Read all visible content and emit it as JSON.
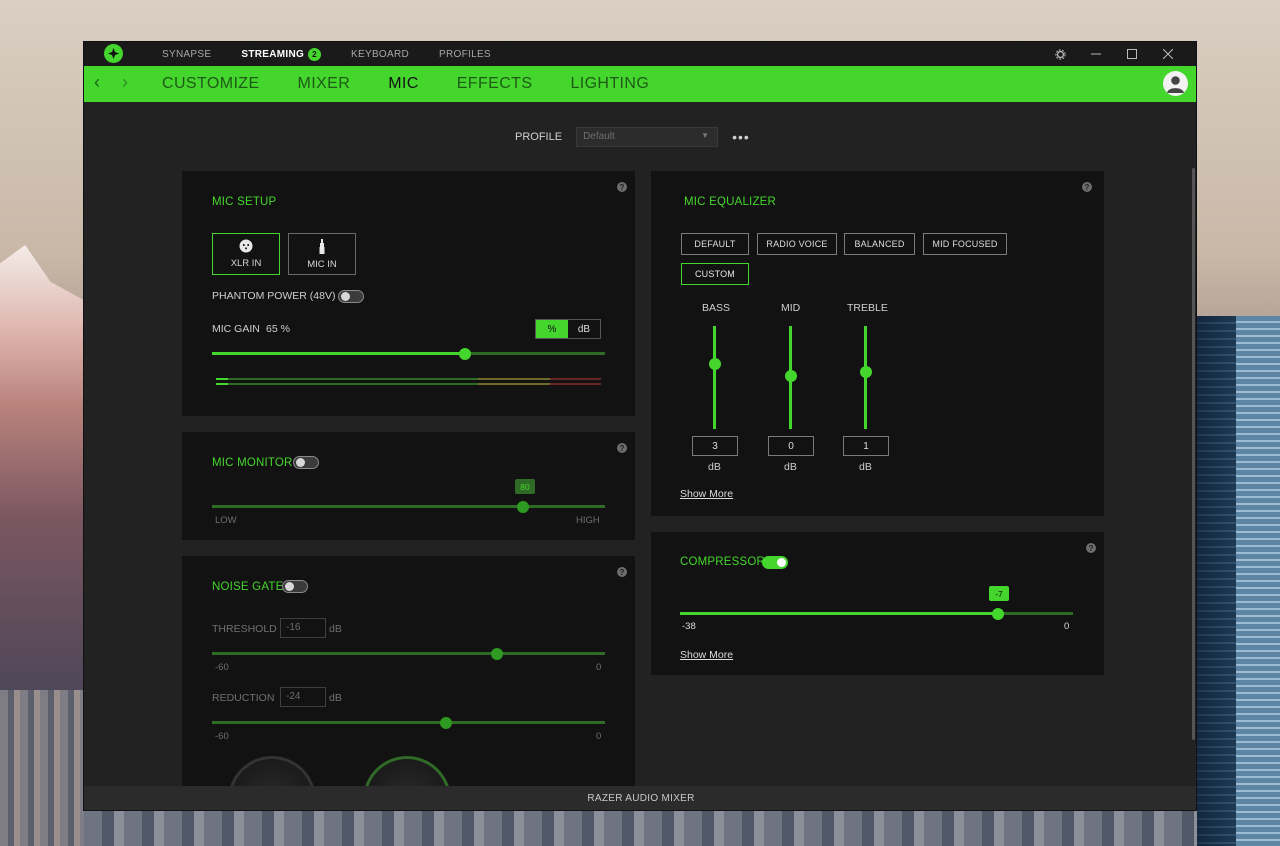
{
  "titlebar": {
    "tabs": [
      {
        "label": "SYNAPSE"
      },
      {
        "label": "STREAMING",
        "badge": "2"
      },
      {
        "label": "KEYBOARD"
      },
      {
        "label": "PROFILES"
      }
    ],
    "settings_icon": "gear-icon",
    "minimize_icon": "minimize-icon",
    "maximize_icon": "maximize-icon",
    "close_icon": "close-icon"
  },
  "nav": {
    "back": "‹",
    "forward": "›",
    "tabs": [
      {
        "label": "CUSTOMIZE"
      },
      {
        "label": "MIXER"
      },
      {
        "label": "MIC"
      },
      {
        "label": "EFFECTS"
      },
      {
        "label": "LIGHTING"
      }
    ],
    "active_tab": "MIC"
  },
  "profile": {
    "label": "PROFILE",
    "value": "Default",
    "more": "•••"
  },
  "mic_setup": {
    "title": "MIC SETUP",
    "sources": [
      {
        "label": "XLR IN",
        "icon": "xlr-icon",
        "active": true
      },
      {
        "label": "MIC IN",
        "icon": "jack-icon",
        "active": false
      }
    ],
    "phantom_power": {
      "label": "PHANTOM POWER (48V)",
      "on": false
    },
    "mic_gain": {
      "label": "MIC GAIN",
      "value": "65",
      "unit": "%",
      "fraction": 0.65
    },
    "units": [
      "%",
      "dB"
    ],
    "active_unit": "%"
  },
  "mic_monitor": {
    "title": "MIC MONITOR",
    "on": false,
    "value": "80",
    "fraction": 0.8,
    "low_label": "LOW",
    "high_label": "HIGH"
  },
  "noise_gate": {
    "title": "NOISE GATE",
    "on": false,
    "threshold": {
      "label": "THRESHOLD",
      "value": "-16",
      "unit": "dB",
      "min": "-60",
      "max": "0",
      "fraction": 0.73
    },
    "reduction": {
      "label": "REDUCTION",
      "value": "-24",
      "unit": "dB",
      "min": "-60",
      "max": "0",
      "fraction": 0.6
    }
  },
  "mic_equalizer": {
    "title": "MIC EQUALIZER",
    "presets": [
      "DEFAULT",
      "RADIO VOICE",
      "BALANCED",
      "MID FOCUSED",
      "CUSTOM"
    ],
    "active_preset": "CUSTOM",
    "bands": [
      {
        "label": "BASS",
        "value": "3",
        "unit": "dB"
      },
      {
        "label": "MID",
        "value": "0",
        "unit": "dB"
      },
      {
        "label": "TREBLE",
        "value": "1",
        "unit": "dB"
      }
    ],
    "show_more": "Show More"
  },
  "compressor": {
    "title": "COMPRESSOR",
    "on": true,
    "value": "-7",
    "min": "-38",
    "max": "0",
    "show_more": "Show More"
  },
  "statusbar": {
    "label": "RAZER AUDIO MIXER"
  },
  "help_glyph": "?",
  "colors": {
    "accent": "#44d62c",
    "panel": "#121212",
    "background": "#222222"
  }
}
